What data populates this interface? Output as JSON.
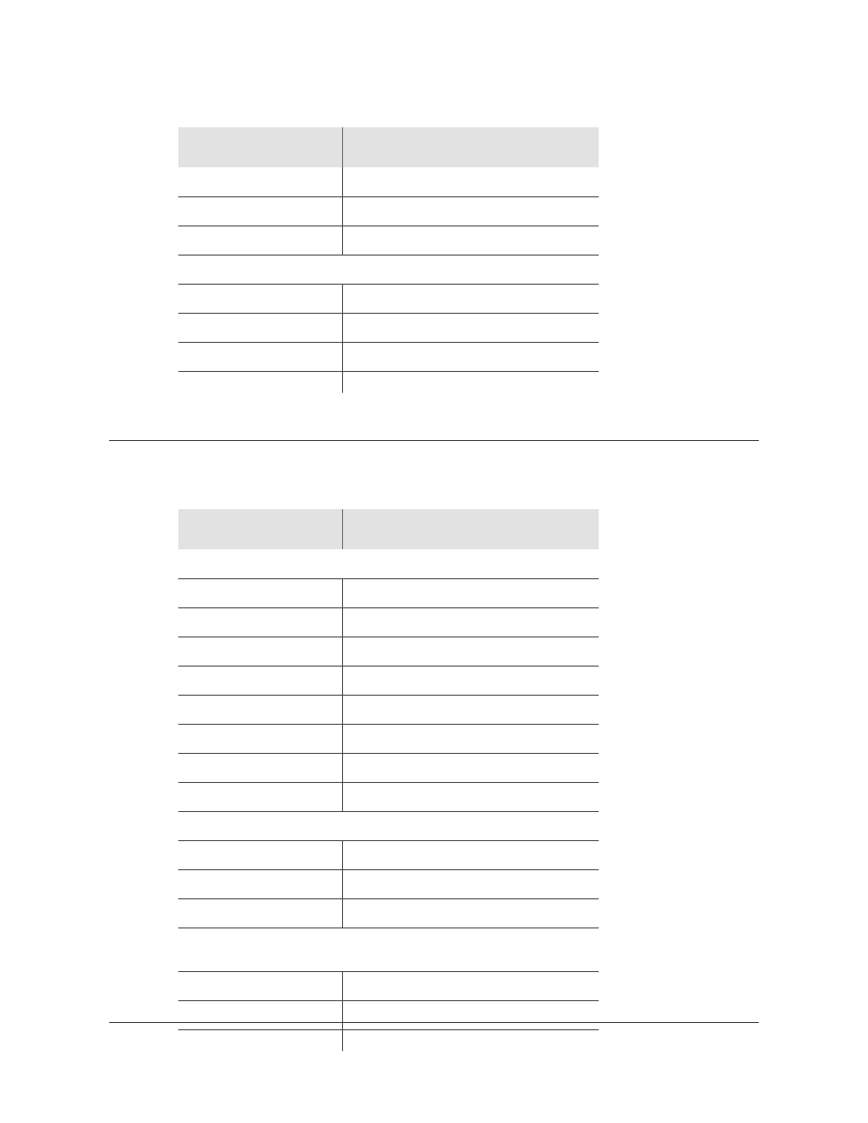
{
  "table1": {
    "headers": {
      "left": "",
      "right": ""
    },
    "rows": [
      {
        "left": "",
        "right": ""
      },
      {
        "left": "",
        "right": ""
      },
      {
        "left": "",
        "right": ""
      }
    ],
    "group1_label": "",
    "rows2": [
      {
        "left": "",
        "right": ""
      },
      {
        "left": "",
        "right": ""
      },
      {
        "left": "",
        "right": ""
      }
    ]
  },
  "table2": {
    "headers": {
      "left": "",
      "right": ""
    },
    "group1_label": "",
    "rows1": [
      {
        "left": "",
        "right": ""
      },
      {
        "left": "",
        "right": ""
      },
      {
        "left": "",
        "right": ""
      },
      {
        "left": "",
        "right": ""
      },
      {
        "left": "",
        "right": ""
      },
      {
        "left": "",
        "right": ""
      },
      {
        "left": "",
        "right": ""
      },
      {
        "left": "",
        "right": ""
      }
    ],
    "group2_label": "",
    "rows2": [
      {
        "left": "",
        "right": ""
      },
      {
        "left": "",
        "right": ""
      },
      {
        "left": "",
        "right": ""
      }
    ],
    "group3_label": "",
    "rows3": [
      {
        "left": "",
        "right": ""
      },
      {
        "left": "",
        "right": ""
      }
    ]
  }
}
